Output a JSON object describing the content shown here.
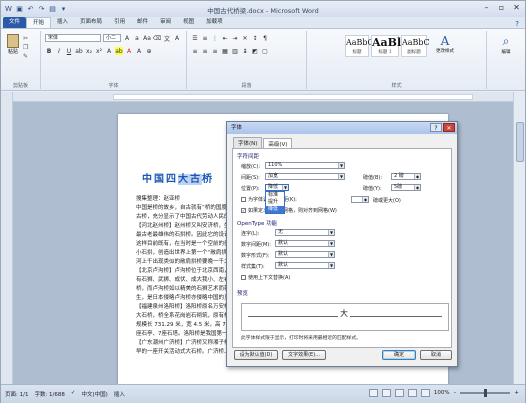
{
  "window": {
    "title": "中国古代桥梁.docx - Microsoft Word"
  },
  "ribbon": {
    "tabs": [
      "文件",
      "开始",
      "插入",
      "页面布局",
      "引用",
      "邮件",
      "审阅",
      "视图",
      "加载项"
    ],
    "clipboard": {
      "paste_label": "粘贴",
      "group_label": "剪贴板"
    },
    "font": {
      "font_name": "宋体",
      "font_size": "小二",
      "group_label": "字体"
    },
    "paragraph": {
      "group_label": "段落"
    },
    "styles": {
      "items": [
        {
          "sample": "AaBbC",
          "name": "标题"
        },
        {
          "sample": "AaBl",
          "name": "标题 1"
        },
        {
          "sample": "AaBbC",
          "name": "副标题"
        }
      ],
      "change_styles": "更改样式",
      "group_label": "样式"
    },
    "editing": {
      "label": "编辑"
    }
  },
  "document": {
    "title_text": "中国四大古桥",
    "title_selected": "大古",
    "lines": [
      "搜集整理：赵亚桥",
      "中国是桥的故乡，自古就有“桥的国度”之称，",
      "古桥，充分显示了中国古代劳动人民的智慧。",
      "【河北赵州桥】赵州桥又叫安济桥，坐落在",
      "最古老最雄伟的石拱桥。因此它的设计者也",
      "这样目前既有，在当时是一个空前的创举。",
      "小石拱，创造出世界上第一个“敞肩拱”，",
      "河上千出现类似的敞肩拱桥要晚一千二百多年。",
      "【北京卢沟桥】卢沟桥位于北京西南，",
      "有石狮、武狮、成伏、成大我小、左右大小",
      "桥，而卢沟桥如以精美的石狮艺术而著称，",
      "生，是日本侵略卢沟桥亦侵略中国的见证。",
      "【福建泉州洛阳桥】洛阳桥原名万安桥，",
      "大石桥，桥全系花岗岩石砌筑，原有桥墩",
      "规模长 731.29 米，宽 4.5 米，高 7.3 米，",
      "座石亭、7座石塔。洛阳桥是我国第一座海",
      "【广东潮州广济桥】广济桥又称湘子桥，位于广东省潮州东门外，是中国古桥中",
      "早的一座开关活动式大石桥。广济桥上有望楼，为我国桥梁史上所仅见，广济桥与赵州桥、"
    ]
  },
  "dialog": {
    "title": "字体",
    "tabs": [
      "字体(N)",
      "高级(V)"
    ],
    "char_spacing_section": "字符间距",
    "scale_label": "缩放(C):",
    "scale_value": "110%",
    "spacing_label": "间距(S):",
    "spacing_value": "加宽",
    "spacing_by_label": "磅值(B):",
    "spacing_by_value": "2 磅",
    "position_label": "位置(P):",
    "position_value": "降低",
    "position_by_label": "磅值(Y):",
    "position_by_value": "5磅",
    "position_options": [
      "标准",
      "提升",
      "降低"
    ],
    "kerning_label": "为字体调整字间距(K):",
    "kerning_suffix": "磅或更大(O)",
    "grid_label": "如果定义了文档网格，则对齐到网格(W)",
    "opentype_section": "OpenType 功能",
    "ligatures_label": "连字(L):",
    "ligatures_value": "无",
    "num_spacing_label": "数字间距(M):",
    "num_spacing_value": "默认",
    "num_forms_label": "数字形式(F):",
    "num_forms_value": "默认",
    "style_sets_label": "样式集(T):",
    "style_sets_value": "默认",
    "contextual_label": "使用上下文替换(A)",
    "preview_section": "预览",
    "preview_text": "大",
    "note": "此字体样式限于显示，打印时将采用最相近的匹配样式。",
    "buttons": {
      "default": "设为默认值(D)",
      "effects": "文字效果(E)...",
      "ok": "确定",
      "cancel": "取消"
    }
  },
  "statusbar": {
    "page": "页面: 1/1",
    "words": "字数: 1/688",
    "language": "中文(中国)",
    "mode": "插入",
    "zoom": "100%"
  }
}
